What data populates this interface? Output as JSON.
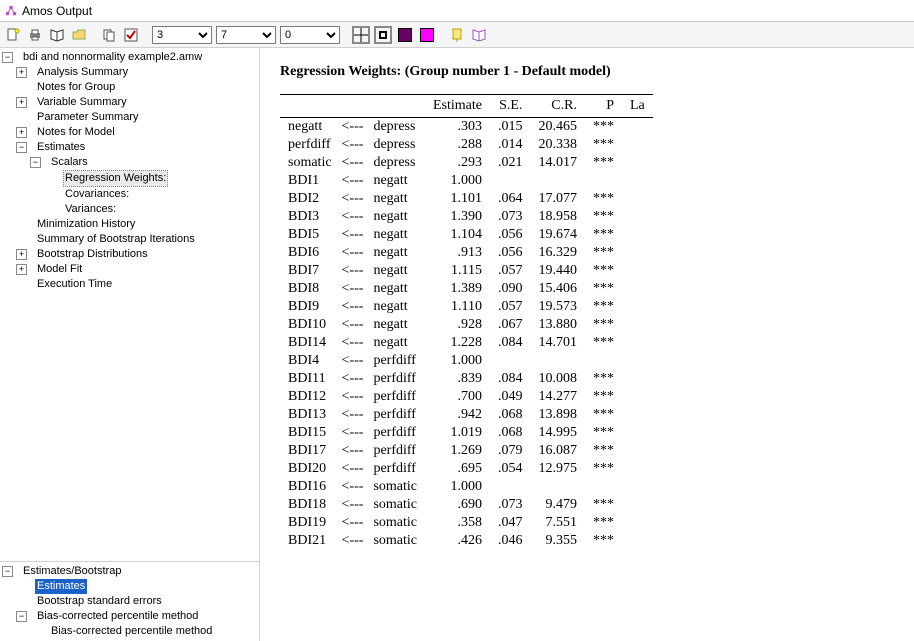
{
  "window": {
    "title": "Amos Output"
  },
  "toolbar": {
    "combo1": "3",
    "combo2": "7",
    "combo3": "0"
  },
  "tree_upper": [
    {
      "indent": 0,
      "toggle": "-",
      "label": "bdi and nonnormality example2.amw"
    },
    {
      "indent": 1,
      "toggle": "+",
      "label": "Analysis Summary"
    },
    {
      "indent": 1,
      "toggle": "",
      "label": "Notes for Group"
    },
    {
      "indent": 1,
      "toggle": "+",
      "label": "Variable Summary"
    },
    {
      "indent": 1,
      "toggle": "",
      "label": "Parameter Summary"
    },
    {
      "indent": 1,
      "toggle": "+",
      "label": "Notes for Model"
    },
    {
      "indent": 1,
      "toggle": "-",
      "label": "Estimates"
    },
    {
      "indent": 2,
      "toggle": "-",
      "label": "Scalars"
    },
    {
      "indent": 3,
      "toggle": "",
      "label": "Regression Weights:",
      "hilite": true
    },
    {
      "indent": 3,
      "toggle": "",
      "label": "Covariances:"
    },
    {
      "indent": 3,
      "toggle": "",
      "label": "Variances:"
    },
    {
      "indent": 1,
      "toggle": "",
      "label": "Minimization History"
    },
    {
      "indent": 1,
      "toggle": "",
      "label": "Summary of Bootstrap Iterations"
    },
    {
      "indent": 1,
      "toggle": "+",
      "label": "Bootstrap Distributions"
    },
    {
      "indent": 1,
      "toggle": "+",
      "label": "Model Fit"
    },
    {
      "indent": 1,
      "toggle": "",
      "label": "Execution Time"
    }
  ],
  "tree_lower": [
    {
      "indent": 0,
      "toggle": "-",
      "label": "Estimates/Bootstrap"
    },
    {
      "indent": 1,
      "toggle": "",
      "label": "Estimates",
      "selected": true
    },
    {
      "indent": 1,
      "toggle": "",
      "label": "Bootstrap standard errors"
    },
    {
      "indent": 1,
      "toggle": "-",
      "label": "Bias-corrected percentile method"
    },
    {
      "indent": 2,
      "toggle": "",
      "label": "Bias-corrected percentile method"
    }
  ],
  "content": {
    "title": "Regression Weights: (Group number 1 - Default model)",
    "headers": [
      "",
      "",
      "",
      "Estimate",
      "S.E.",
      "C.R.",
      "P",
      "La"
    ],
    "rows": [
      {
        "to": "negatt",
        "from": "depress",
        "est": ".303",
        "se": ".015",
        "cr": "20.465",
        "p": "***"
      },
      {
        "to": "perfdiff",
        "from": "depress",
        "est": ".288",
        "se": ".014",
        "cr": "20.338",
        "p": "***"
      },
      {
        "to": "somatic",
        "from": "depress",
        "est": ".293",
        "se": ".021",
        "cr": "14.017",
        "p": "***"
      },
      {
        "to": "BDI1",
        "from": "negatt",
        "est": "1.000",
        "se": "",
        "cr": "",
        "p": ""
      },
      {
        "to": "BDI2",
        "from": "negatt",
        "est": "1.101",
        "se": ".064",
        "cr": "17.077",
        "p": "***"
      },
      {
        "to": "BDI3",
        "from": "negatt",
        "est": "1.390",
        "se": ".073",
        "cr": "18.958",
        "p": "***"
      },
      {
        "to": "BDI5",
        "from": "negatt",
        "est": "1.104",
        "se": ".056",
        "cr": "19.674",
        "p": "***"
      },
      {
        "to": "BDI6",
        "from": "negatt",
        "est": ".913",
        "se": ".056",
        "cr": "16.329",
        "p": "***"
      },
      {
        "to": "BDI7",
        "from": "negatt",
        "est": "1.115",
        "se": ".057",
        "cr": "19.440",
        "p": "***"
      },
      {
        "to": "BDI8",
        "from": "negatt",
        "est": "1.389",
        "se": ".090",
        "cr": "15.406",
        "p": "***"
      },
      {
        "to": "BDI9",
        "from": "negatt",
        "est": "1.110",
        "se": ".057",
        "cr": "19.573",
        "p": "***"
      },
      {
        "to": "BDI10",
        "from": "negatt",
        "est": ".928",
        "se": ".067",
        "cr": "13.880",
        "p": "***"
      },
      {
        "to": "BDI14",
        "from": "negatt",
        "est": "1.228",
        "se": ".084",
        "cr": "14.701",
        "p": "***"
      },
      {
        "to": "BDI4",
        "from": "perfdiff",
        "est": "1.000",
        "se": "",
        "cr": "",
        "p": ""
      },
      {
        "to": "BDI11",
        "from": "perfdiff",
        "est": ".839",
        "se": ".084",
        "cr": "10.008",
        "p": "***"
      },
      {
        "to": "BDI12",
        "from": "perfdiff",
        "est": ".700",
        "se": ".049",
        "cr": "14.277",
        "p": "***"
      },
      {
        "to": "BDI13",
        "from": "perfdiff",
        "est": ".942",
        "se": ".068",
        "cr": "13.898",
        "p": "***"
      },
      {
        "to": "BDI15",
        "from": "perfdiff",
        "est": "1.019",
        "se": ".068",
        "cr": "14.995",
        "p": "***"
      },
      {
        "to": "BDI17",
        "from": "perfdiff",
        "est": "1.269",
        "se": ".079",
        "cr": "16.087",
        "p": "***"
      },
      {
        "to": "BDI20",
        "from": "perfdiff",
        "est": ".695",
        "se": ".054",
        "cr": "12.975",
        "p": "***"
      },
      {
        "to": "BDI16",
        "from": "somatic",
        "est": "1.000",
        "se": "",
        "cr": "",
        "p": ""
      },
      {
        "to": "BDI18",
        "from": "somatic",
        "est": ".690",
        "se": ".073",
        "cr": "9.479",
        "p": "***"
      },
      {
        "to": "BDI19",
        "from": "somatic",
        "est": ".358",
        "se": ".047",
        "cr": "7.551",
        "p": "***"
      },
      {
        "to": "BDI21",
        "from": "somatic",
        "est": ".426",
        "se": ".046",
        "cr": "9.355",
        "p": "***"
      }
    ],
    "arrow": "<---"
  }
}
